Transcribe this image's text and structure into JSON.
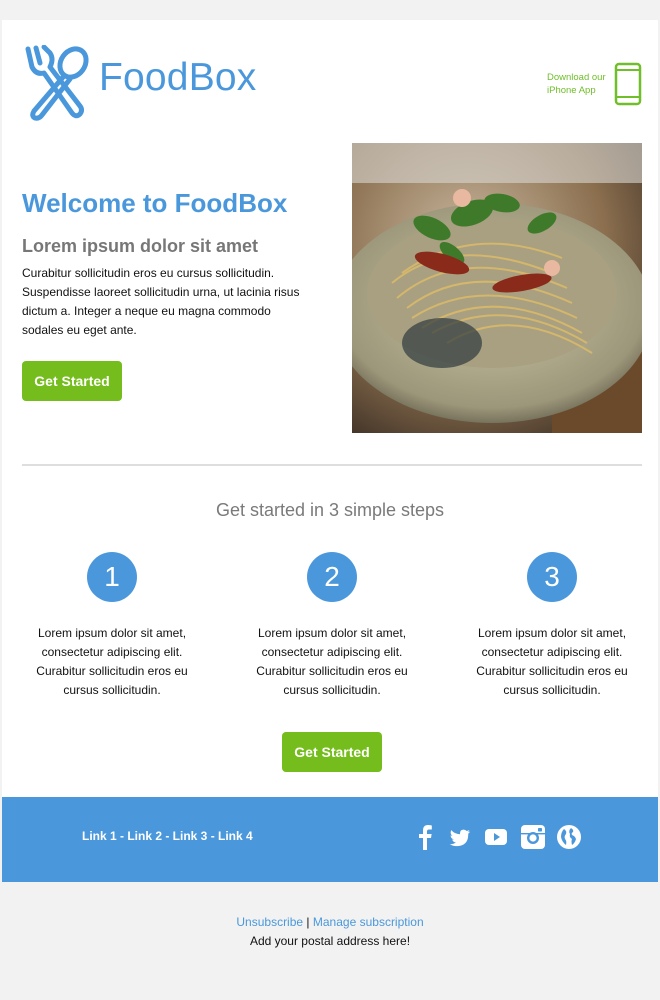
{
  "header": {
    "brand_name": "FoodBox",
    "app_promo_line1": "Download our",
    "app_promo_line2": "iPhone App"
  },
  "hero": {
    "title": "Welcome to FoodBox",
    "subtitle": "Lorem ipsum dolor sit amet",
    "body": "Curabitur sollicitudin eros eu cursus sollicitudin. Suspendisse laoreet sollicitudin urna, ut lacinia risus dictum a. Integer a neque eu magna commodo sodales eu eget ante.",
    "button_label": "Get Started"
  },
  "steps": {
    "title": "Get started in 3 simple steps",
    "items": [
      {
        "number": "1",
        "text": "Lorem ipsum dolor sit amet, consectetur adipiscing elit. Curabitur sollicitudin eros eu cursus sollicitudin."
      },
      {
        "number": "2",
        "text": "Lorem ipsum dolor sit amet, consectetur adipiscing elit. Curabitur sollicitudin eros eu cursus sollicitudin."
      },
      {
        "number": "3",
        "text": "Lorem ipsum dolor sit amet, consectetur adipiscing elit. Curabitur sollicitudin eros eu cursus sollicitudin."
      }
    ],
    "button_label": "Get Started"
  },
  "footer": {
    "links": "Link 1 - Link 2 - Link 3 - Link 4",
    "social_icons": [
      "facebook-icon",
      "twitter-icon",
      "youtube-icon",
      "instagram-icon",
      "globe-icon"
    ],
    "unsubscribe_label": "Unsubscribe",
    "separator": "|",
    "manage_label": "Manage subscription",
    "postal_address": "Add your postal address here!"
  },
  "colors": {
    "accent_blue": "#4a98db",
    "button_green": "#75bd1c",
    "background_gray": "#f2f2f2"
  }
}
